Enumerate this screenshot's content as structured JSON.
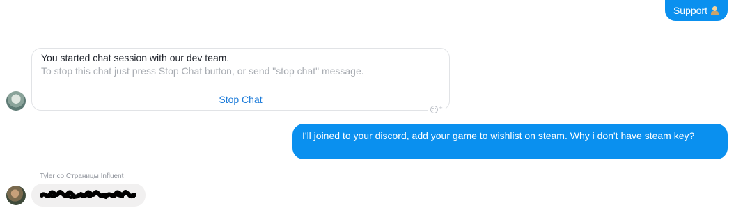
{
  "support_bubble": {
    "label": "Support",
    "emoji_icon": "support-agent-emoji"
  },
  "card": {
    "title": "You started chat session with our dev team.",
    "subtitle": "To stop this chat just press Stop Chat button, or send \"stop chat\" message.",
    "button_label": "Stop Chat",
    "reaction_icon": "add-reaction-icon"
  },
  "outgoing_message": {
    "text": "I'll joined to your discord, add your game to wishlist on steam. Why i don't have steam key?"
  },
  "incoming_message": {
    "sender": "Tyler со Страницы Influent",
    "text_redacted": true
  },
  "colors": {
    "outgoing_bubble": "#0a90ef",
    "incoming_bubble": "#f1f0f0",
    "link_blue": "#1a7ad9"
  }
}
